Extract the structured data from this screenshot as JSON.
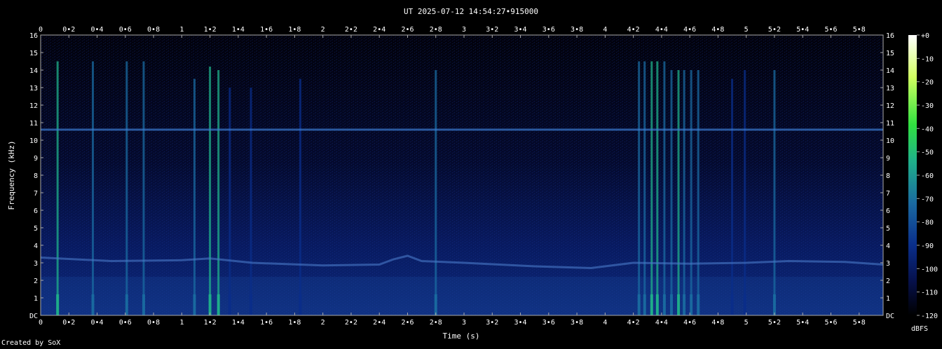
{
  "chart_data": {
    "type": "heatmap",
    "title": "UT 2025-07-12 14:54:27•915000",
    "xlabel": "Time (s)",
    "ylabel": "Frequency (kHz)",
    "colorbar_label": "dBFS",
    "xlim": [
      0,
      5.97
    ],
    "ylim": [
      0,
      16
    ],
    "x_ticks": [
      "0",
      "0•2",
      "0•4",
      "0•6",
      "0•8",
      "1",
      "1•2",
      "1•4",
      "1•6",
      "1•8",
      "2",
      "2•2",
      "2•4",
      "2•6",
      "2•8",
      "3",
      "3•2",
      "3•4",
      "3•6",
      "3•8",
      "4",
      "4•2",
      "4•4",
      "4•6",
      "4•8",
      "5",
      "5•2",
      "5•4",
      "5•6",
      "5•8"
    ],
    "y_ticks": [
      "DC",
      "1",
      "2",
      "3",
      "4",
      "5",
      "6",
      "7",
      "8",
      "9",
      "10",
      "11",
      "12",
      "13",
      "14",
      "15",
      "16"
    ],
    "colorbar_range": [
      -120,
      0
    ],
    "colorbar_ticks": [
      "+0",
      "-10",
      "-20",
      "-30",
      "-40",
      "-50",
      "-60",
      "-70",
      "-80",
      "-90",
      "-100",
      "-110",
      "-120"
    ],
    "grid": false,
    "colormap": [
      "#000000",
      "#06104a",
      "#0a2e8a",
      "#1a6aa0",
      "#1fb08a",
      "#30e040",
      "#d0ff60",
      "#ffffff"
    ],
    "tone_line_khz": 10.6,
    "series": [
      {
        "name": "broadband impulses",
        "x": [
          0.12,
          0.37,
          0.61,
          0.73,
          1.09,
          1.2,
          1.26,
          1.34,
          1.49,
          1.84,
          2.8,
          4.24,
          4.28,
          4.33,
          4.37,
          4.42,
          4.47,
          4.52,
          4.56,
          4.61,
          4.66,
          4.9,
          4.99,
          5.2
        ],
        "intensity_dbfs": [
          -55,
          -70,
          -75,
          -72,
          -72,
          -60,
          -58,
          -80,
          -85,
          -88,
          -75,
          -70,
          -65,
          -60,
          -58,
          -62,
          -65,
          -60,
          -70,
          -72,
          -75,
          -80,
          -78,
          -70
        ],
        "top_khz": [
          14.5,
          14.5,
          14.5,
          14.5,
          13.5,
          14.2,
          14,
          13,
          13,
          13.5,
          14,
          14.5,
          14.5,
          14.5,
          14.5,
          14.5,
          14,
          14,
          14,
          14,
          14,
          13.5,
          14,
          14
        ]
      },
      {
        "name": "low tone contour",
        "x": [
          0,
          0.5,
          1,
          1.2,
          1.5,
          2,
          2.4,
          2.5,
          2.6,
          2.7,
          3,
          3.5,
          3.9,
          4.2,
          4.6,
          5,
          5.3,
          5.7,
          5.97
        ],
        "y_khz": [
          3.3,
          3.1,
          3.15,
          3.25,
          3.0,
          2.85,
          2.9,
          3.2,
          3.4,
          3.1,
          3.0,
          2.8,
          2.7,
          3.0,
          2.95,
          3.0,
          3.1,
          3.05,
          2.9
        ]
      }
    ]
  },
  "footer": {
    "credit": "Created by SoX"
  }
}
